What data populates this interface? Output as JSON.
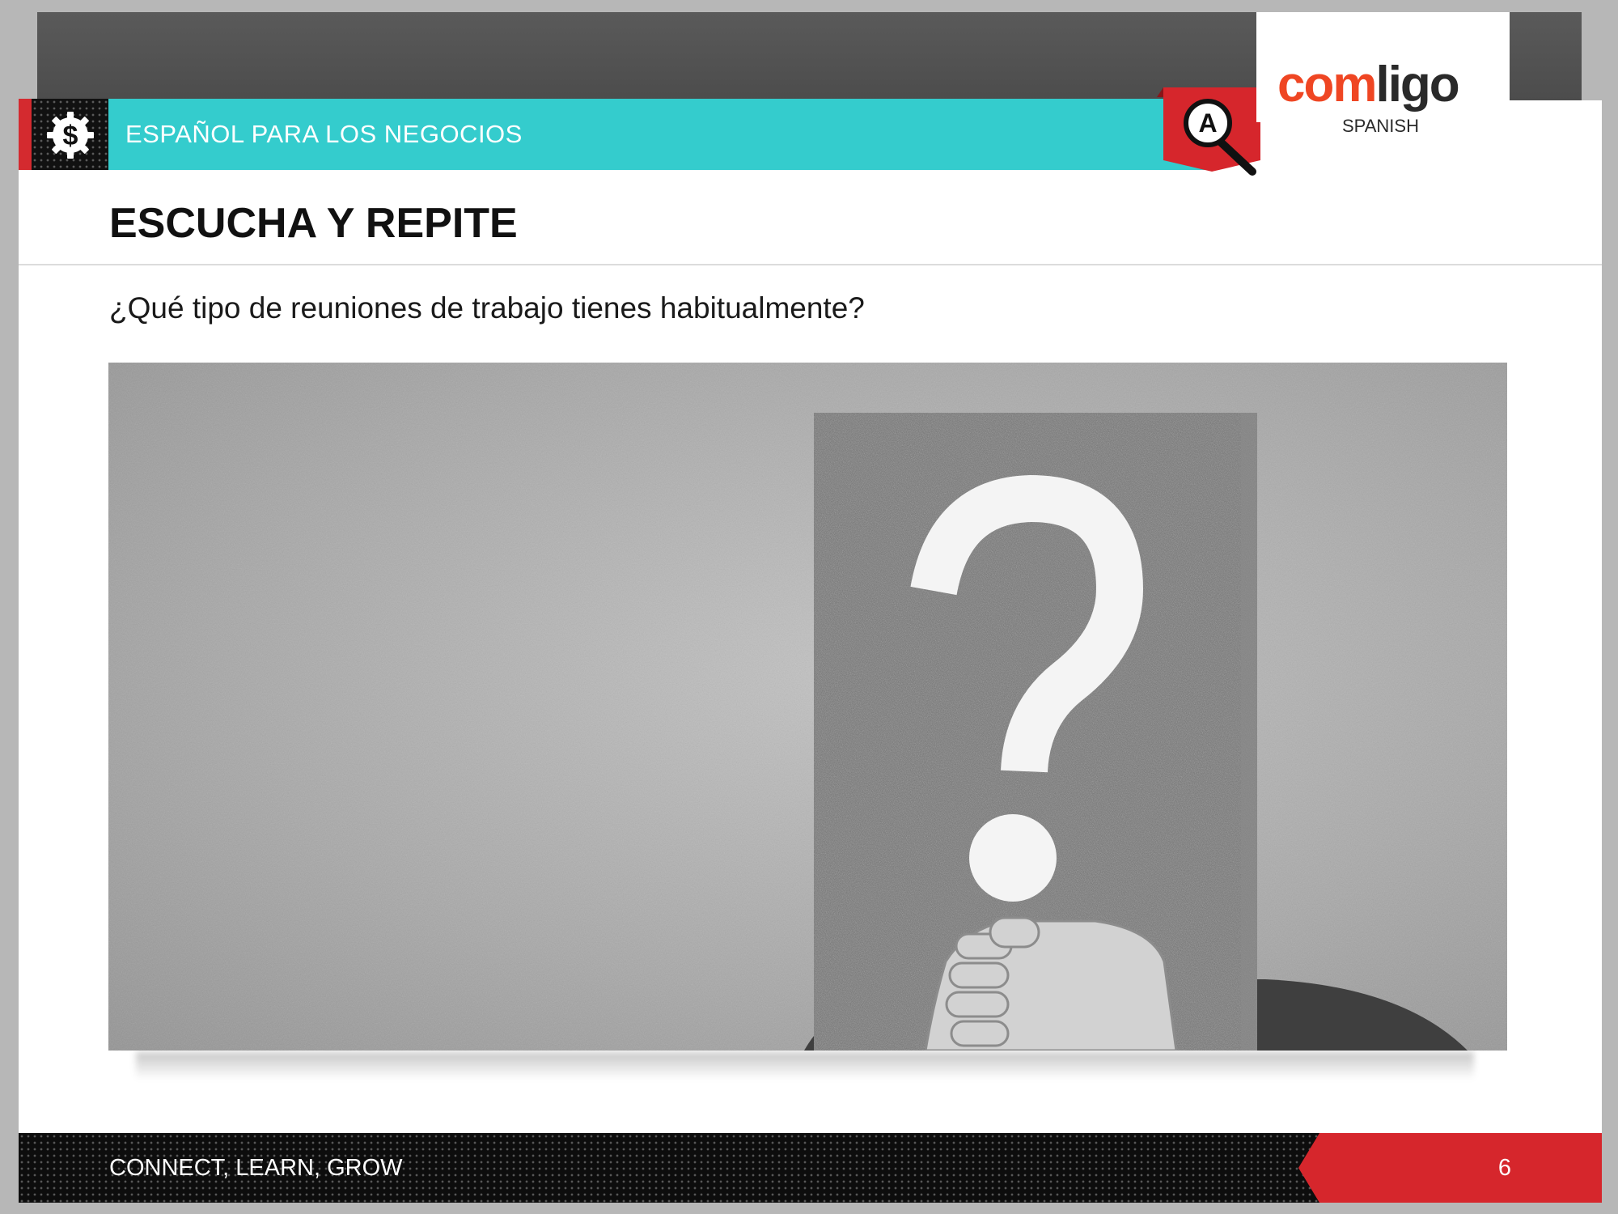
{
  "header": {
    "section_label": "ESPAÑOL PARA LOS NEGOCIOS",
    "icon": "dollar-gear-icon",
    "badge_letter": "A",
    "badge_icon": "magnifier-icon"
  },
  "logo": {
    "wordmark_orange": "com",
    "wordmark_dark": "ligo",
    "sub": "SPANISH"
  },
  "slide": {
    "title": "ESCUCHA Y REPITE",
    "question": "¿Qué tipo de reuniones de trabajo tienes habitualmente?",
    "photo_symbol": "?"
  },
  "footer": {
    "tagline": "CONNECT, LEARN, GROW",
    "page_number": "6"
  },
  "colors": {
    "accent_teal": "#34cccd",
    "accent_red": "#d6262c",
    "logo_orange": "#ef4623",
    "dark": "#111111"
  }
}
